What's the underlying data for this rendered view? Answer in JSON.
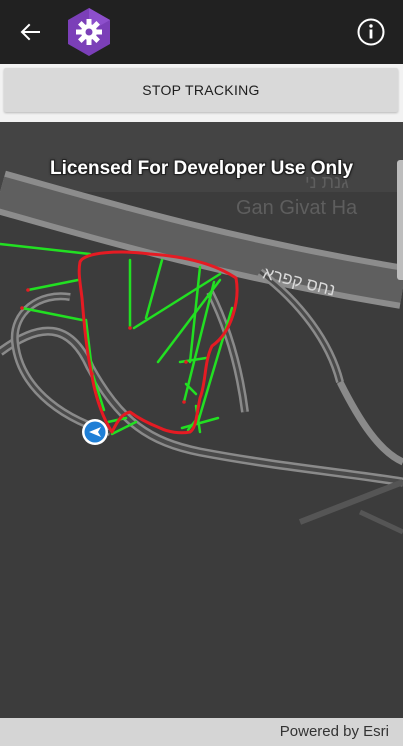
{
  "toolbar": {
    "stop_label": "STOP TRACKING"
  },
  "map": {
    "license_text": "Licensed For Developer Use Only",
    "street_label_hebrew": "נחס קפרא",
    "area_label_partial": "Gan Givat Ha",
    "area_label_hebrew_partial": "גנת ני",
    "attribution": "Powered by Esri"
  },
  "icons": {
    "back": "arrow-left-icon",
    "app": "gear-logo-icon",
    "info": "info-circle-icon",
    "location": "location-arrow-icon"
  },
  "colors": {
    "appbar": "#212121",
    "logo_purple": "#7b3fb8",
    "track_outline": "#e51b23",
    "track_lines": "#22e022",
    "location_marker": "#1f7fd6"
  }
}
